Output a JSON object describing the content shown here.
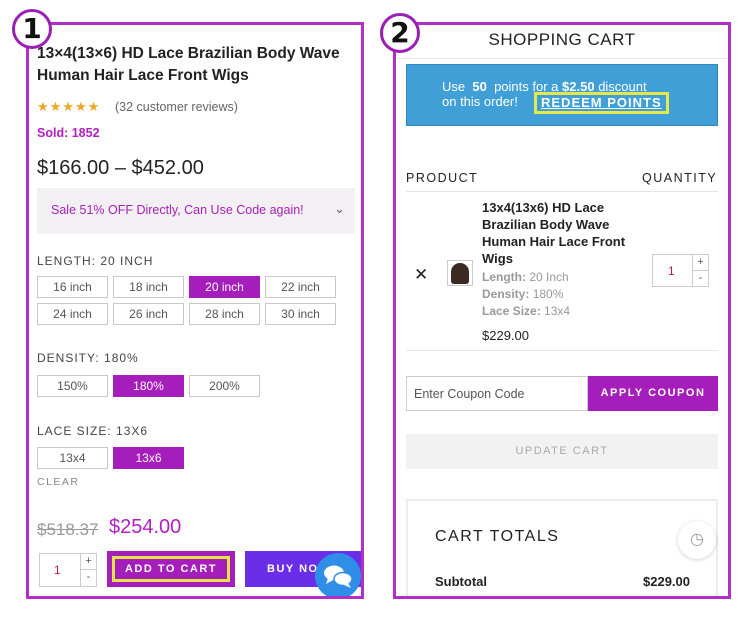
{
  "steps": [
    "1",
    "2"
  ],
  "product": {
    "title": "13×4(13×6) HD Lace Brazilian Body Wave Human Hair Lace Front Wigs",
    "stars": "★★★★★",
    "reviews": "(32 customer reviews)",
    "sold": "Sold: 1852",
    "price_range": "$166.00 – $452.00",
    "sale_banner": "Sale 51% OFF Directly, Can Use Code again!",
    "length": {
      "label": "LENGTH: 20 INCH",
      "options": [
        "16 inch",
        "18 inch",
        "20 inch",
        "22 inch",
        "24 inch",
        "26 inch",
        "28 inch",
        "30 inch"
      ],
      "selected": "20 inch"
    },
    "density": {
      "label": "DENSITY: 180%",
      "options": [
        "150%",
        "180%",
        "200%"
      ],
      "selected": "180%"
    },
    "lace_size": {
      "label": "LACE SIZE: 13X6",
      "options": [
        "13x4",
        "13x6"
      ],
      "selected": "13x6"
    },
    "clear_label": "CLEAR",
    "old_price": "$518.37",
    "new_price": "$254.00",
    "quantity": "1",
    "add_to_cart": "ADD TO CART",
    "buy_now": "BUY NO"
  },
  "cart": {
    "title": "SHOPPING CART",
    "points_line1_pre": "Use",
    "points_amount": "50",
    "points_line1_mid": "points for a",
    "points_discount": "$2.50",
    "points_line1_post": "discount",
    "points_line2": "on this order!",
    "redeem_label": "REDEEM POINTS",
    "col_product": "PRODUCT",
    "col_quantity": "QUANTITY",
    "item": {
      "name": "13x4(13x6) HD Lace Brazilian Body Wave Human Hair Lace Front Wigs",
      "length_label": "Length:",
      "length_value": "20 Inch",
      "density_label": "Density:",
      "density_value": "180%",
      "lace_label": "Lace Size:",
      "lace_value": "13x4",
      "price": "$229.00",
      "quantity": "1"
    },
    "coupon_placeholder": "Enter Coupon Code",
    "apply_coupon": "APPLY COUPON",
    "update_cart": "UPDATE CART",
    "totals_title": "CART TOTALS",
    "subtotal_label": "Subtotal",
    "subtotal_value": "$229.00"
  },
  "colors": {
    "accent": "#a51dbb",
    "points_banner": "#3f9fd6",
    "highlight": "#e4e84a",
    "buy_now": "#6a2ee8"
  }
}
